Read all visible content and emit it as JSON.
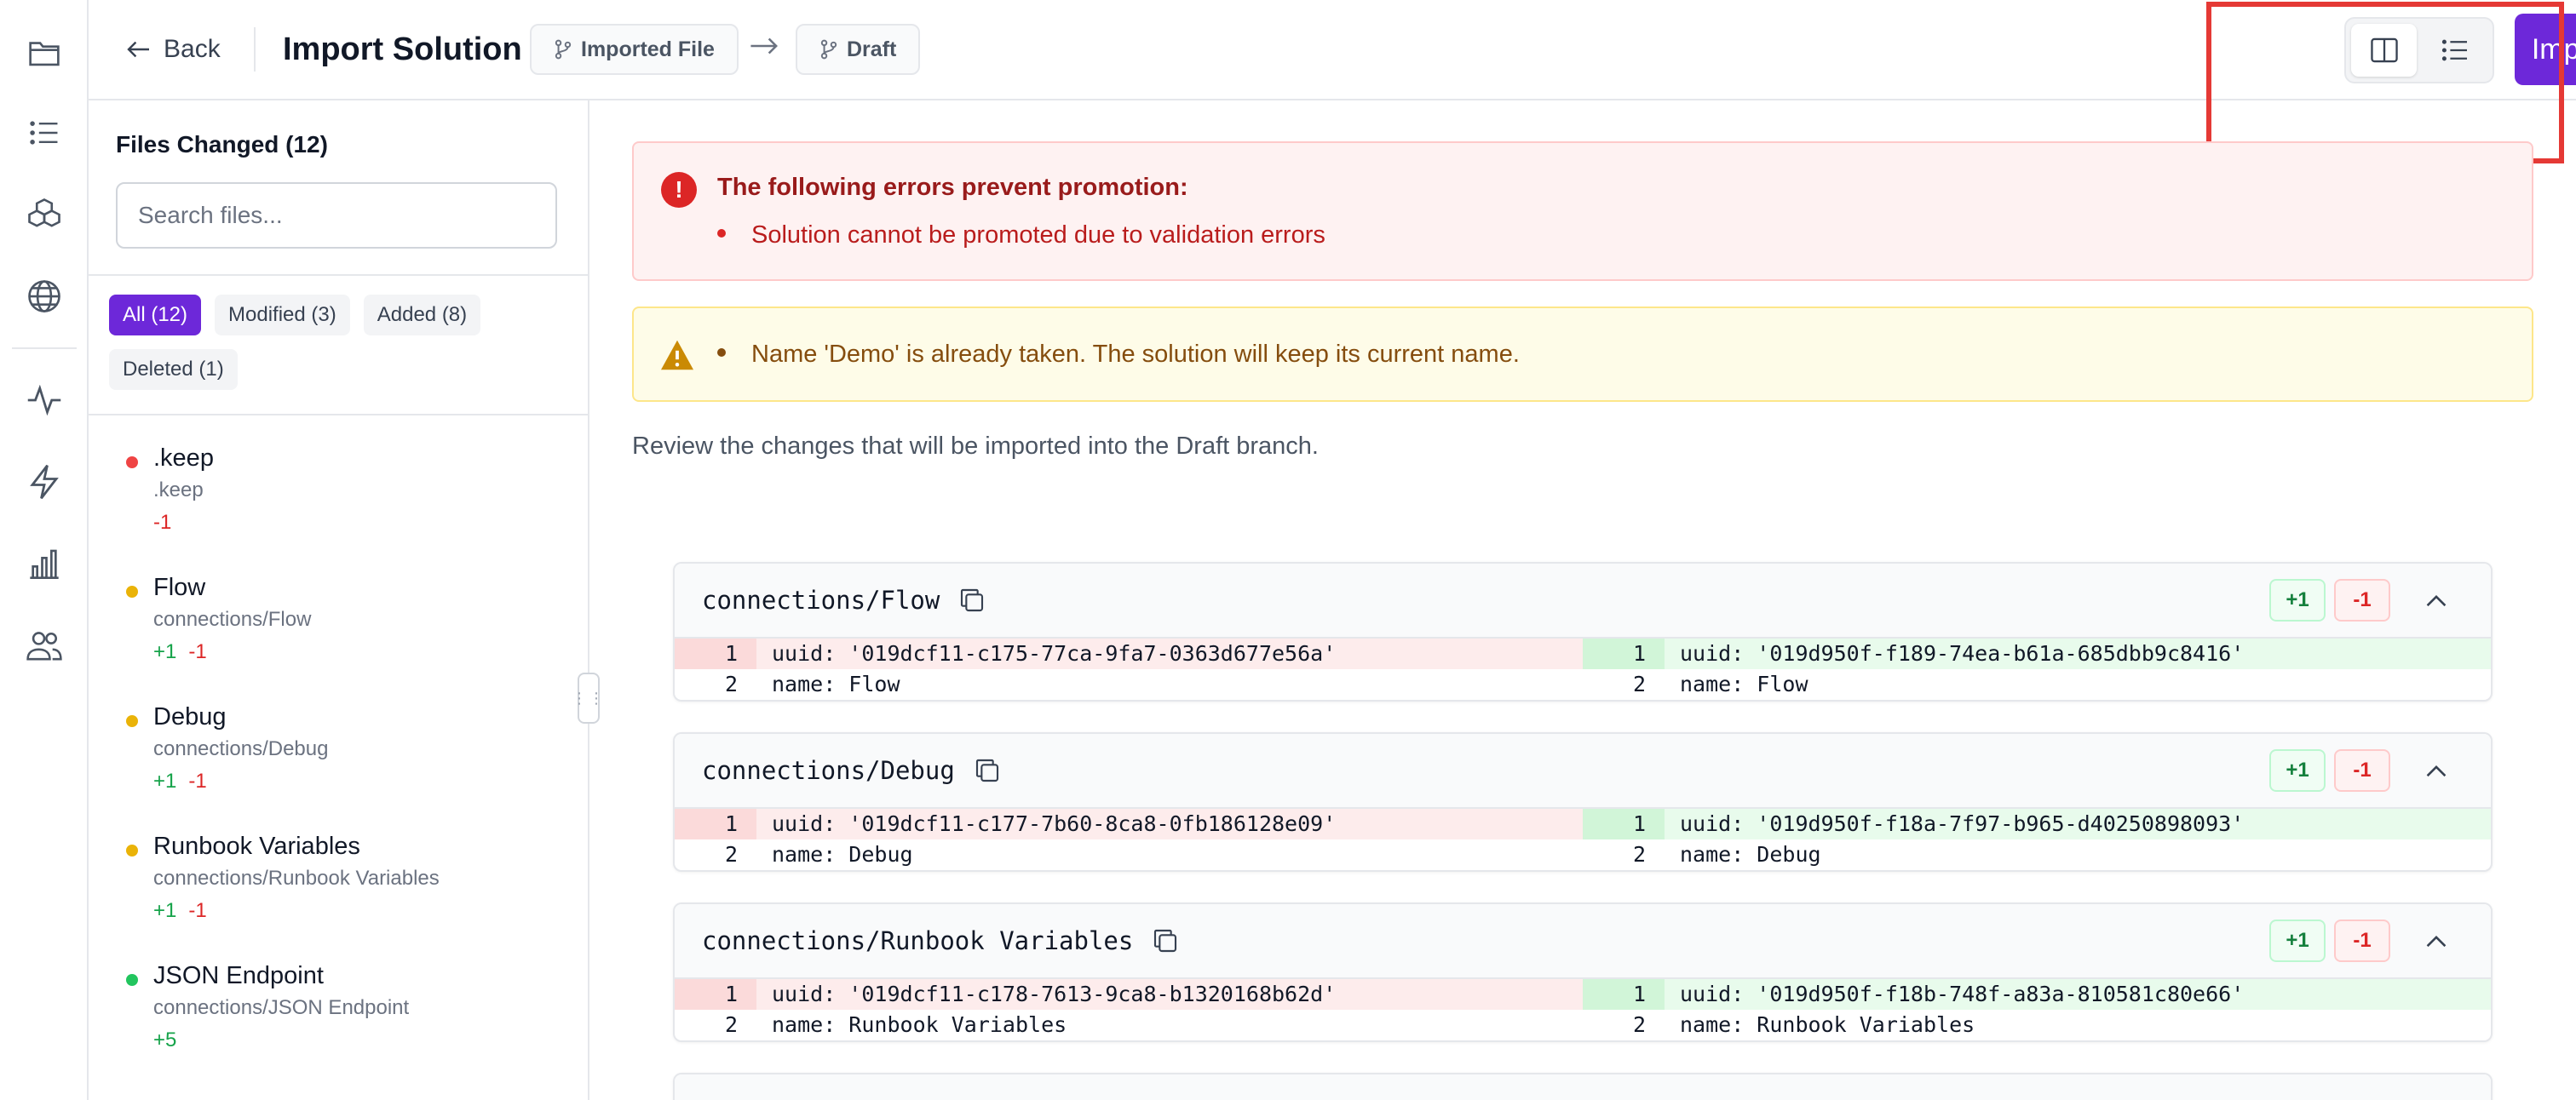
{
  "header": {
    "back_label": "Back",
    "title": "Import Solution",
    "source_label": "Imported File",
    "target_label": "Draft",
    "import_label": "Import"
  },
  "rail": {
    "icons": [
      "folder-icon",
      "list-icon",
      "cubes-icon",
      "globe-icon",
      "activity-icon",
      "bolt-icon",
      "bar-chart-icon",
      "users-icon"
    ]
  },
  "sidebar": {
    "title": "Files Changed (12)",
    "search_placeholder": "Search files...",
    "filters": [
      {
        "label": "All (12)",
        "active": true
      },
      {
        "label": "Modified (3)",
        "active": false
      },
      {
        "label": "Added (8)",
        "active": false
      },
      {
        "label": "Deleted (1)",
        "active": false
      }
    ],
    "files": [
      {
        "name": ".keep",
        "path": ".keep",
        "plus": "",
        "minus": "-1",
        "status_color": "#ef4444"
      },
      {
        "name": "Flow",
        "path": "connections/Flow",
        "plus": "+1",
        "minus": "-1",
        "status_color": "#eab308"
      },
      {
        "name": "Debug",
        "path": "connections/Debug",
        "plus": "+1",
        "minus": "-1",
        "status_color": "#eab308"
      },
      {
        "name": "Runbook Variables",
        "path": "connections/Runbook Variables",
        "plus": "+1",
        "minus": "-1",
        "status_color": "#eab308"
      },
      {
        "name": "JSON Endpoint",
        "path": "connections/JSON Endpoint",
        "plus": "+5",
        "minus": "",
        "status_color": "#22c55e"
      }
    ]
  },
  "main": {
    "error_title": "The following errors prevent promotion:",
    "error_items": [
      "Solution cannot be promoted due to validation errors"
    ],
    "warning_text": "Name 'Demo' is already taken. The solution will keep its current name.",
    "review_text": "Review the changes that will be imported into the Draft branch.",
    "diffs": [
      {
        "path": "connections/Flow",
        "plus": "+1",
        "minus": "-1",
        "old": [
          {
            "n": "1",
            "text": "uuid: '019dcf11-c175-77ca-9fa7-0363d677e56a'"
          },
          {
            "n": "2",
            "text": "name: Flow"
          }
        ],
        "new": [
          {
            "n": "1",
            "text": "uuid: '019d950f-f189-74ea-b61a-685dbb9c8416'"
          },
          {
            "n": "2",
            "text": "name: Flow"
          }
        ]
      },
      {
        "path": "connections/Debug",
        "plus": "+1",
        "minus": "-1",
        "old": [
          {
            "n": "1",
            "text": "uuid: '019dcf11-c177-7b60-8ca8-0fb186128e09'"
          },
          {
            "n": "2",
            "text": "name: Debug"
          }
        ],
        "new": [
          {
            "n": "1",
            "text": "uuid: '019d950f-f18a-7f97-b965-d40250898093'"
          },
          {
            "n": "2",
            "text": "name: Debug"
          }
        ]
      },
      {
        "path": "connections/Runbook Variables",
        "plus": "+1",
        "minus": "-1",
        "old": [
          {
            "n": "1",
            "text": "uuid: '019dcf11-c178-7613-9ca8-b1320168b62d'"
          },
          {
            "n": "2",
            "text": "name: Runbook Variables"
          }
        ],
        "new": [
          {
            "n": "1",
            "text": "uuid: '019d950f-f18b-748f-a83a-810581c80e66'"
          },
          {
            "n": "2",
            "text": "name: Runbook Variables"
          }
        ]
      }
    ]
  }
}
